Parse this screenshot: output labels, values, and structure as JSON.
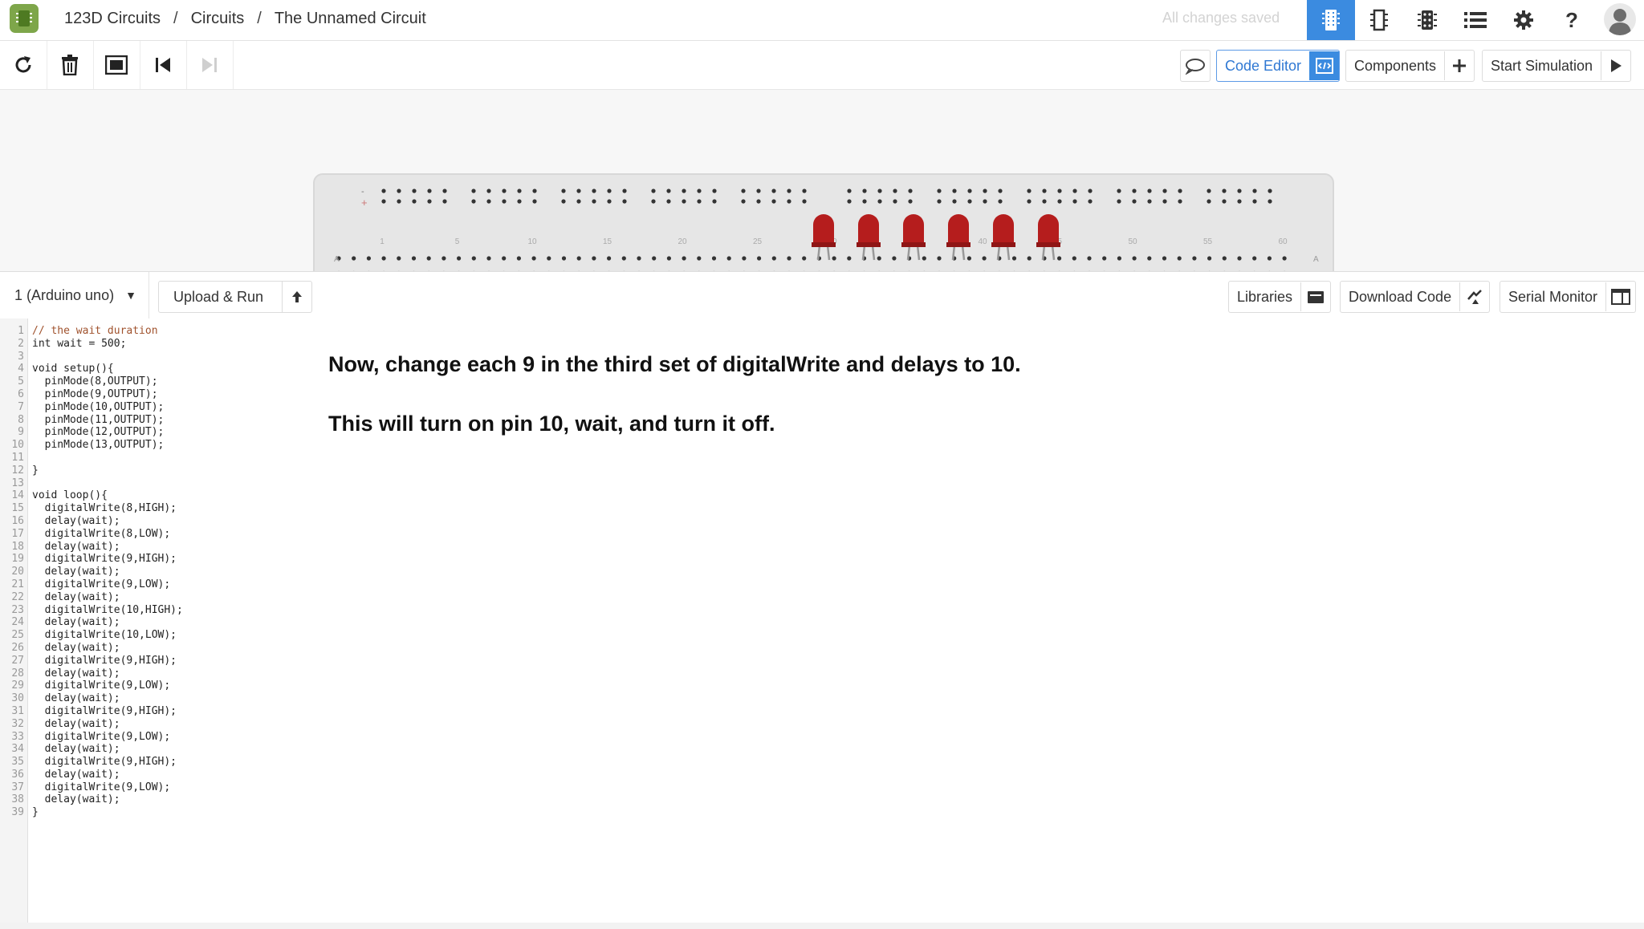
{
  "header": {
    "breadcrumb": [
      "123D Circuits",
      "Circuits",
      "The Unnamed Circuit"
    ],
    "breadcrumb_separator": "/",
    "save_status": "All changes saved",
    "icons": [
      "breadboard-view-icon",
      "schematic-view-icon",
      "pcb-view-icon",
      "list-view-icon",
      "gear-icon",
      "help-icon"
    ],
    "help_label": "?"
  },
  "toolbar": {
    "tools": [
      "rotate-icon",
      "delete-icon",
      "fit-to-screen-icon",
      "step-back-icon",
      "step-forward-icon"
    ],
    "code_editor": "Code Editor",
    "components": "Components",
    "start_simulation": "Start Simulation"
  },
  "breadboard": {
    "column_labels": [
      "1",
      "5",
      "10",
      "15",
      "20",
      "25",
      "30",
      "35",
      "40",
      "45",
      "50",
      "55",
      "60"
    ],
    "row_marks": [
      "-",
      "+"
    ],
    "row_letter": "A",
    "led_count": 6,
    "led_color": "#b51d1d"
  },
  "code_panel": {
    "board": "1 (Arduino uno)",
    "upload_run": "Upload & Run",
    "libraries": "Libraries",
    "download_code": "Download Code",
    "serial_monitor": "Serial Monitor"
  },
  "code": [
    "// the wait duration",
    "int wait = 500;",
    "",
    "void setup(){",
    "  pinMode(8,OUTPUT);",
    "  pinMode(9,OUTPUT);",
    "  pinMode(10,OUTPUT);",
    "  pinMode(11,OUTPUT);",
    "  pinMode(12,OUTPUT);",
    "  pinMode(13,OUTPUT);",
    "",
    "}",
    "",
    "void loop(){",
    "  digitalWrite(8,HIGH);",
    "  delay(wait);",
    "  digitalWrite(8,LOW);",
    "  delay(wait);",
    "  digitalWrite(9,HIGH);",
    "  delay(wait);",
    "  digitalWrite(9,LOW);",
    "  delay(wait);",
    "  digitalWrite(10,HIGH);",
    "  delay(wait);",
    "  digitalWrite(10,LOW);",
    "  delay(wait);",
    "  digitalWrite(9,HIGH);",
    "  delay(wait);",
    "  digitalWrite(9,LOW);",
    "  delay(wait);",
    "  digitalWrite(9,HIGH);",
    "  delay(wait);",
    "  digitalWrite(9,LOW);",
    "  delay(wait);",
    "  digitalWrite(9,HIGH);",
    "  delay(wait);",
    "  digitalWrite(9,LOW);",
    "  delay(wait);",
    "}"
  ],
  "instruction": {
    "line1": "Now, change each 9 in the third set of digitalWrite and delays to 10.",
    "line2": "This will turn on pin 10, wait, and turn it off."
  },
  "colors": {
    "accent": "#3b8be0",
    "logo": "#7ea64a",
    "comment": "#a0522d"
  }
}
